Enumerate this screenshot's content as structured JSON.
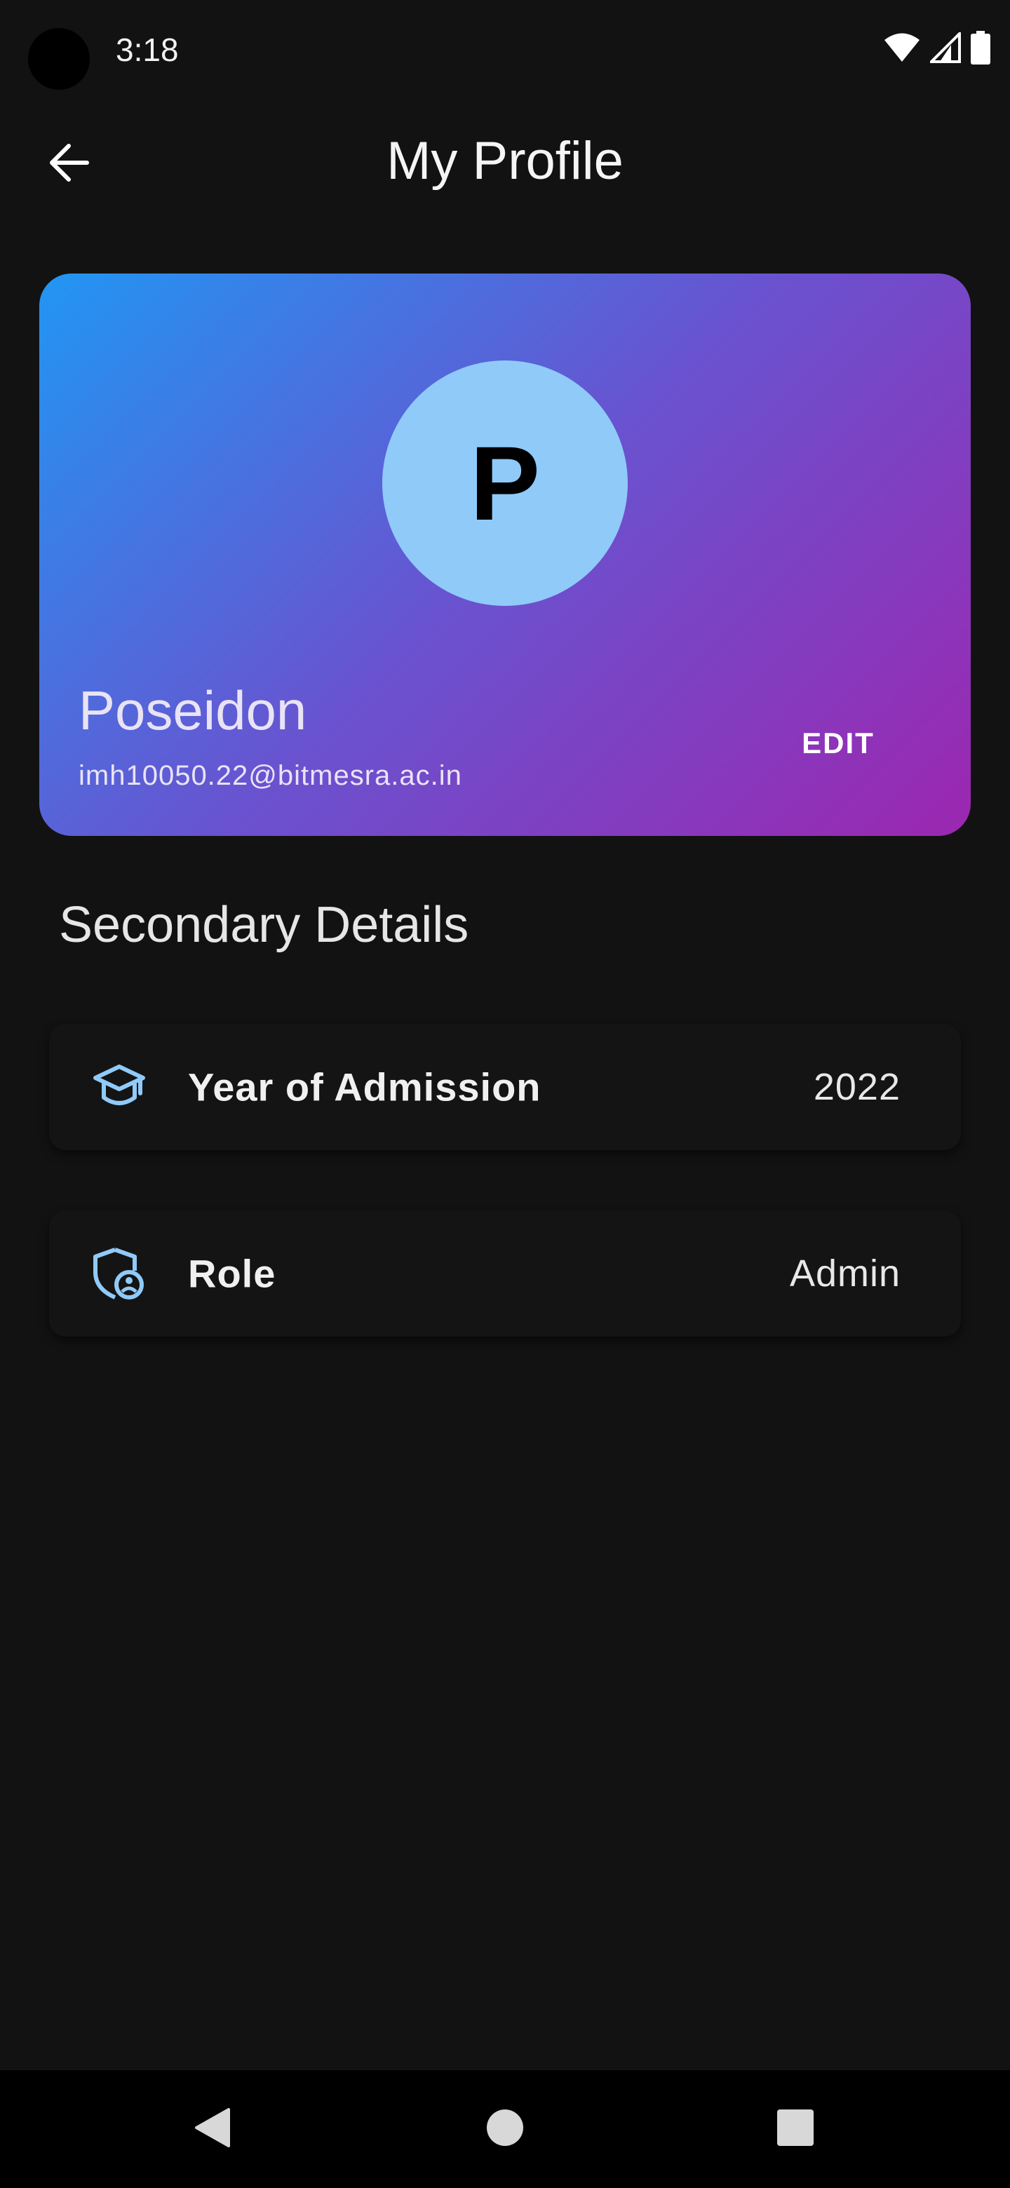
{
  "status_bar": {
    "time": "3:18"
  },
  "app_bar": {
    "title": "My Profile",
    "back_icon": "arrow-left-icon"
  },
  "profile": {
    "avatar_initial": "P",
    "name": "Poseidon",
    "email": "imh10050.22@bitmesra.ac.in",
    "edit_label": "EDIT",
    "avatar_color": "#90caf9",
    "gradient_start": "#2196f3",
    "gradient_end": "#9c27b0"
  },
  "secondary": {
    "title": "Secondary Details",
    "items": [
      {
        "icon": "graduation-cap-icon",
        "label": "Year of Admission",
        "value": "2022"
      },
      {
        "icon": "shield-user-icon",
        "label": "Role",
        "value": "Admin"
      }
    ]
  },
  "nav": {
    "back_icon": "triangle-back-icon",
    "home_icon": "circle-home-icon",
    "recents_icon": "square-recents-icon"
  },
  "colors": {
    "background": "#121212",
    "accent_icon": "#90caf9"
  }
}
